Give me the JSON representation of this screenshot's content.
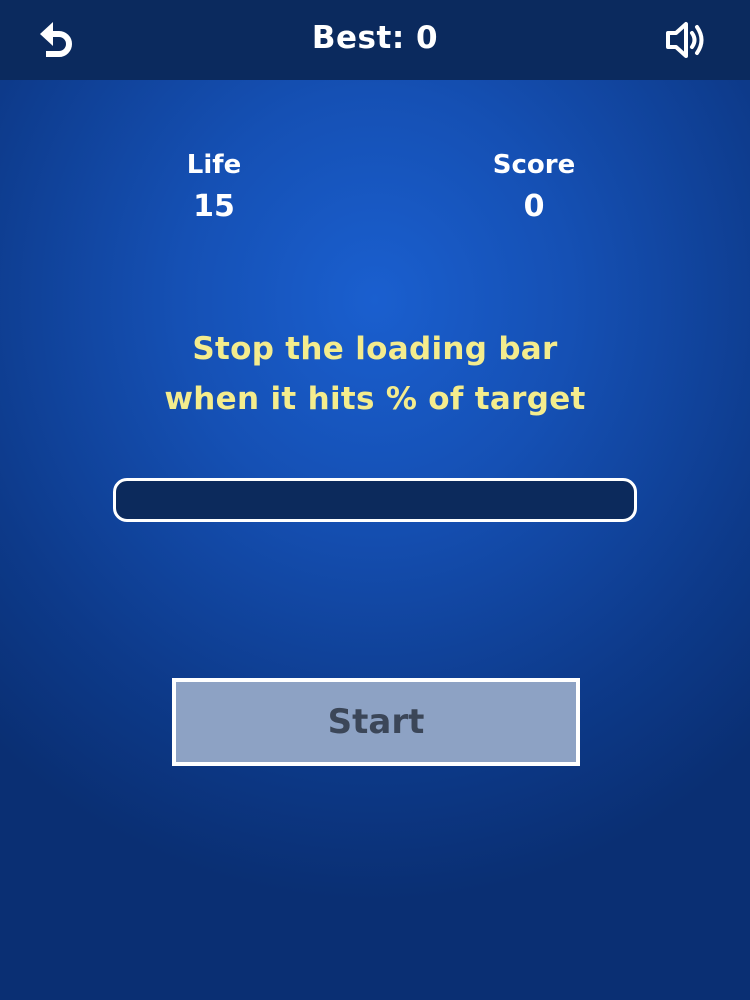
{
  "header": {
    "best_label": "Best: 0",
    "back_icon": "undo-arrow-icon",
    "sound_icon": "speaker-on-icon"
  },
  "stats": {
    "life_label": "Life",
    "life_value": "15",
    "score_label": "Score",
    "score_value": "0"
  },
  "instructions": {
    "line1": "Stop the loading bar",
    "line2": "when it hits % of target"
  },
  "loading_bar": {
    "progress": 0
  },
  "start_button": {
    "label": "Start"
  },
  "colors": {
    "background": "#1550b4",
    "topbar": "#0b2a5e",
    "instruction_text": "#f4ec8d",
    "start_button_bg": "#8da2c4",
    "start_button_text": "#3b4658"
  }
}
